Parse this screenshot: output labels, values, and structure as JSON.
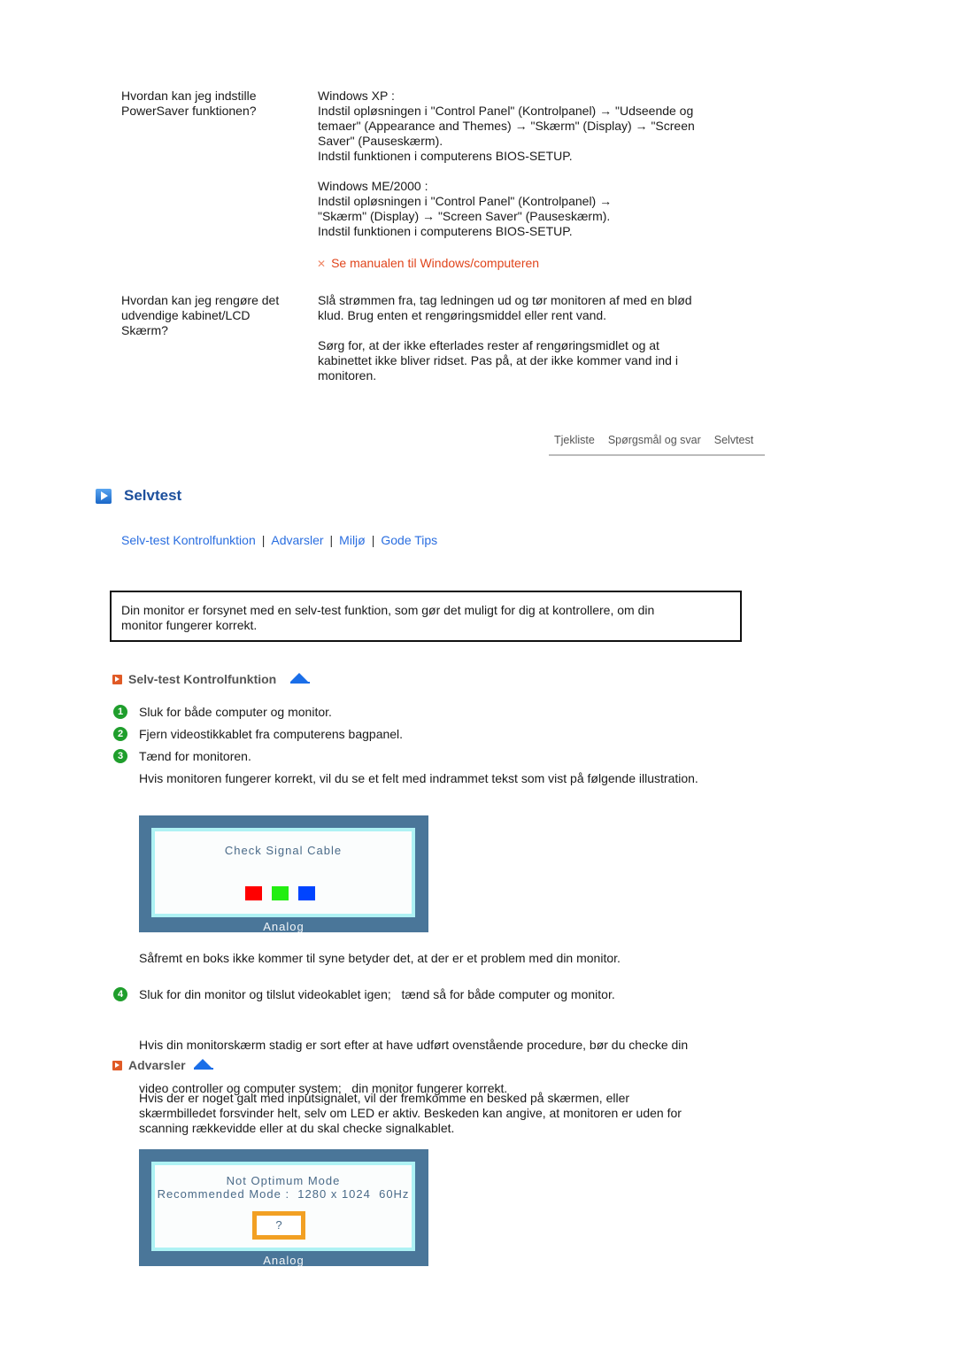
{
  "faq": [
    {
      "question": [
        "Hvordan kan jeg indstille",
        "PowerSaver funktionen?"
      ],
      "answer_blocks": [
        [
          "Windows XP :",
          "Indstil opløsningen i \"Control Panel\" (Kontrolpanel) → \"Udseende og",
          "temaer\" (Appearance and Themes) → \"Skærm\" (Display) → \"Screen",
          "Saver\" (Pauseskærm).",
          "Indstil funktionen i computerens BIOS-SETUP."
        ],
        [
          "Windows ME/2000 :",
          "Indstil opløsningen i \"Control Panel\" (Kontrolpanel) →",
          "\"Skærm\" (Display) → \"Screen Saver\" (Pauseskærm).",
          "Indstil funktionen i computerens BIOS-SETUP."
        ]
      ],
      "note": "Se manualen til Windows/computeren",
      "note_icon": "x-mark-icon"
    },
    {
      "question": [
        "Hvordan kan jeg rengøre det",
        "udvendige kabinet/LCD",
        "Skærm?"
      ],
      "answer_blocks": [
        [
          "Slå strømmen fra, tag ledningen ud og tør monitoren af med en blød",
          "klud. Brug enten et rengøringsmiddel eller rent vand."
        ],
        [
          "Sørg for, at der ikke efterlades rester af rengøringsmidlet og at",
          "kabinettet ikke bliver ridset. Pas på, at der ikke kommer vand ind i",
          "monitoren."
        ]
      ]
    }
  ],
  "mini_nav": [
    "Tjekliste",
    "Spørgsmål og svar",
    "Selvtest"
  ],
  "section": {
    "title": "Selvtest",
    "icon": "play-square-icon",
    "links": [
      "Selv-test Kontrolfunktion",
      "Advarsler",
      "Miljø",
      "Gode Tips"
    ],
    "intro": [
      "Din monitor er forsynet med en selv-test funktion, som gør det muligt for dig at kontrollere, om din",
      "monitor fungerer korrekt."
    ]
  },
  "selftest": {
    "title": "Selv-test Kontrolfunktion",
    "steps": [
      {
        "num": "1",
        "text": "Sluk for både computer og monitor."
      },
      {
        "num": "2",
        "text": "Fjern videostikkablet fra computerens bagpanel."
      },
      {
        "num": "3",
        "text": "Tænd for monitoren."
      }
    ],
    "step3_detail": "Hvis monitoren fungerer korrekt, vil du se et felt med indrammet tekst som vist på følgende illustration.",
    "osd1": {
      "message": "Check Signal Cable",
      "label": "Analog",
      "colors": [
        "#ff0000",
        "#22ee11",
        "#0044ff"
      ]
    },
    "after_osd": "Såfremt en boks ikke kommer til syne betyder det, at der er et problem med din monitor.",
    "step4": {
      "num": "4",
      "text": "Sluk for din monitor og tilslut videokablet igen;   tænd så for både computer og monitor."
    },
    "step4_detail": [
      "Hvis din monitorskærm stadig er sort efter at have udført ovenstående procedure, bør du checke din",
      "video controller og computer system;   din monitor fungerer korrekt."
    ]
  },
  "warnings": {
    "title": "Advarsler",
    "text": [
      "Hvis der er noget galt med inputsignalet, vil der fremkomme en besked på skærmen, eller",
      "skærmbilledet forsvinder helt, selv om LED er aktiv. Beskeden kan angive, at monitoren er uden for",
      "scanning rækkevidde eller at du skal checke signalkablet."
    ],
    "osd2": {
      "line1": "Not Optimum Mode",
      "line2": "Recommended Mode :  1280 x 1024  60Hz",
      "button": "?",
      "label": "Analog"
    }
  }
}
